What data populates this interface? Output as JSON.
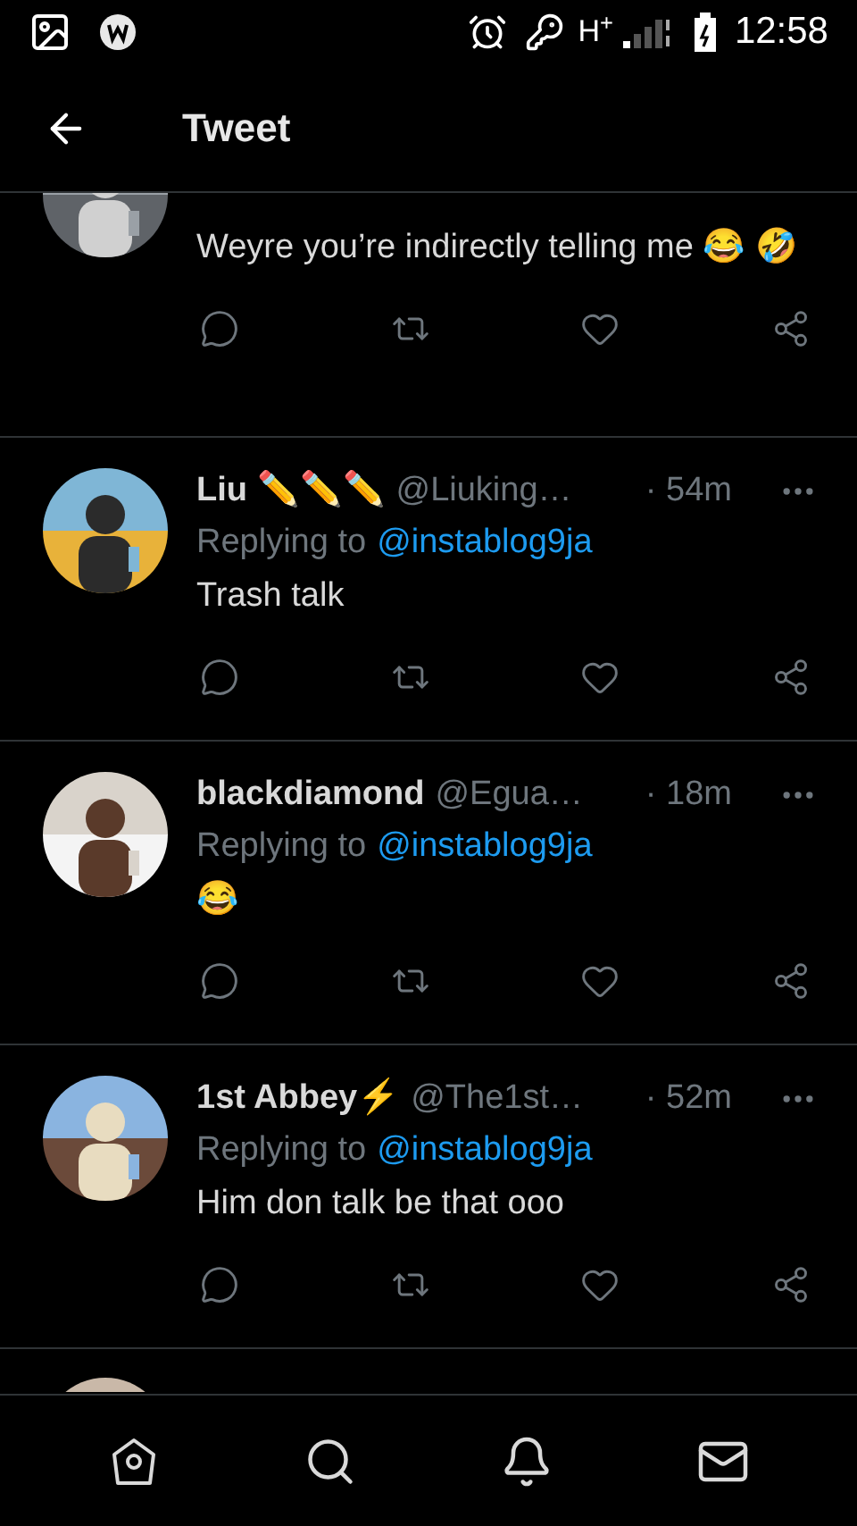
{
  "status_bar": {
    "time": "12:58",
    "network": "H$^{+}$"
  },
  "header": {
    "title": "Tweet"
  },
  "tweets": [
    {
      "kind": "partial",
      "text": "Weyre you’re indirectly telling me 😂 🤣"
    },
    {
      "kind": "full",
      "name": "Liu ✏️✏️✏️",
      "handle": "@Liuking…",
      "time": "· 54m",
      "replying_label": "Replying to",
      "replying_handle": "@instablog9ja",
      "text": "Trash talk"
    },
    {
      "kind": "full",
      "name": "blackdiamond",
      "handle": "@Egua…",
      "time": "· 18m",
      "replying_label": "Replying to",
      "replying_handle": "@instablog9ja",
      "text": "😂"
    },
    {
      "kind": "full",
      "name": "1st Abbey⚡",
      "handle": "@The1st…",
      "time": "· 52m",
      "replying_label": "Replying to",
      "replying_handle": "@instablog9ja",
      "text": "Him don talk be that ooo"
    },
    {
      "kind": "cut"
    }
  ],
  "bottom_nav": [
    {
      "kind": "home"
    },
    {
      "kind": "search"
    },
    {
      "kind": "notifications"
    },
    {
      "kind": "messages"
    }
  ]
}
